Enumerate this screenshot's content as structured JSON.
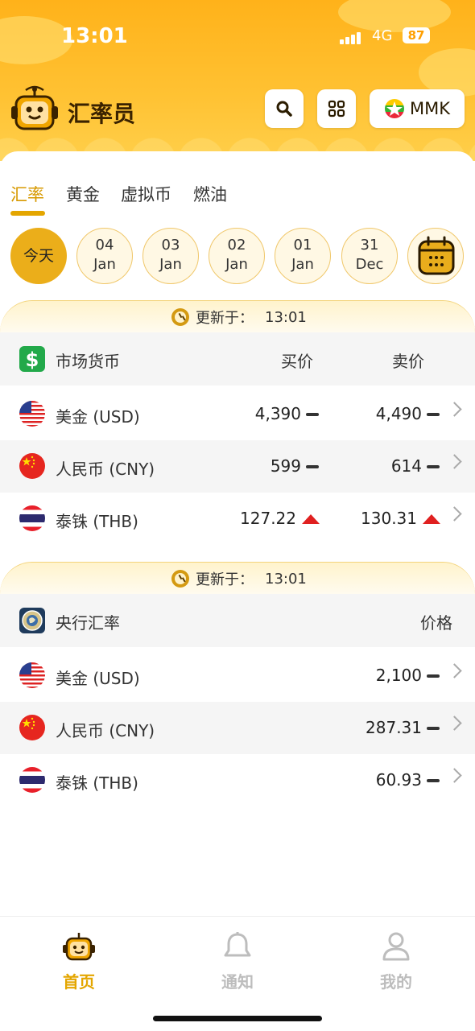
{
  "status_bar": {
    "time": "13:01",
    "network": "4G",
    "battery": "87"
  },
  "app": {
    "title": "汇率员",
    "currency_code": "MMK"
  },
  "tabs": [
    {
      "label": "汇率",
      "active": true
    },
    {
      "label": "黄金",
      "active": false
    },
    {
      "label": "虚拟币",
      "active": false
    },
    {
      "label": "燃油",
      "active": false
    }
  ],
  "dates": {
    "today": "今天",
    "items": [
      {
        "day": "04",
        "month": "Jan"
      },
      {
        "day": "03",
        "month": "Jan"
      },
      {
        "day": "02",
        "month": "Jan"
      },
      {
        "day": "01",
        "month": "Jan"
      },
      {
        "day": "31",
        "month": "Dec"
      }
    ]
  },
  "market": {
    "updated_label": "更新于：",
    "updated_time": "13:01",
    "header": {
      "label": "市场货币",
      "buy": "买价",
      "sell": "卖价"
    },
    "rows": [
      {
        "name": "美金 (USD)",
        "buy": "4,390",
        "buy_trend": "flat",
        "sell": "4,490",
        "sell_trend": "flat"
      },
      {
        "name": "人民币 (CNY)",
        "buy": "599",
        "buy_trend": "flat",
        "sell": "614",
        "sell_trend": "flat"
      },
      {
        "name": "泰铢 (THB)",
        "buy": "127.22",
        "buy_trend": "up",
        "sell": "130.31",
        "sell_trend": "up"
      }
    ]
  },
  "central": {
    "updated_label": "更新于：",
    "updated_time": "13:01",
    "header": {
      "label": "央行汇率",
      "price": "价格"
    },
    "rows": [
      {
        "name": "美金 (USD)",
        "price": "2,100",
        "trend": "flat"
      },
      {
        "name": "人民币 (CNY)",
        "price": "287.31",
        "trend": "flat"
      },
      {
        "name": "泰铢 (THB)",
        "price": "60.93",
        "trend": "flat"
      }
    ]
  },
  "bottom_nav": [
    {
      "label": "首页",
      "active": true
    },
    {
      "label": "通知",
      "active": false
    },
    {
      "label": "我的",
      "active": false
    }
  ],
  "colors": {
    "accent": "#e4a600",
    "up": "#e02020",
    "header_bg": "#ffb21a"
  }
}
